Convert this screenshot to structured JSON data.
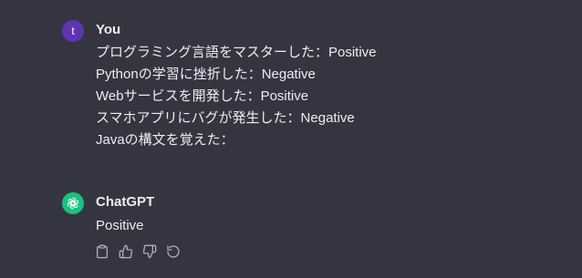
{
  "conversation": {
    "user": {
      "avatar_letter": "t",
      "author": "You",
      "lines": [
        "プログラミング言語をマスターした：Positive",
        "Pythonの学習に挫折した：Negative",
        "Webサービスを開発した：Positive",
        "スマホアプリにバグが発生した：Negative",
        "Javaの構文を覚えた："
      ]
    },
    "assistant": {
      "author": "ChatGPT",
      "lines": [
        "Positive"
      ]
    }
  },
  "colors": {
    "background": "#343541",
    "user_avatar": "#5e35b1",
    "assistant_avatar": "#19c37d",
    "text": "#ececf1",
    "icon": "#acacbe"
  },
  "icons": {
    "actions": [
      "clipboard-icon",
      "thumbs-up-icon",
      "thumbs-down-icon",
      "regenerate-icon"
    ]
  }
}
